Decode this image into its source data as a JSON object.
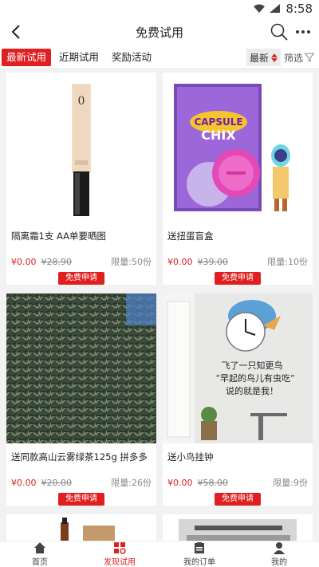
{
  "status": {
    "time": "8:58"
  },
  "header": {
    "title": "免费试用"
  },
  "tabs": [
    {
      "label": "最新试用",
      "active": true
    },
    {
      "label": "近期试用",
      "active": false
    },
    {
      "label": "奖励活动",
      "active": false
    }
  ],
  "sort": {
    "label": "最新"
  },
  "filter": {
    "label": "筛选"
  },
  "products": [
    {
      "name": "隔离霜1支 AA单要晒图",
      "price": "¥0.00",
      "orig": "¥28.90",
      "limit": "限量:50份",
      "button": "免费申请"
    },
    {
      "name": "送扭蛋盲盒",
      "price": "¥0.00",
      "orig": "¥39.00",
      "limit": "限量:10份",
      "button": "免费申请"
    },
    {
      "name": "送同款高山云雾绿茶125g 拼多多",
      "price": "¥0.00",
      "orig": "¥20.00",
      "limit": "限量:26份",
      "button": "免费申请"
    },
    {
      "name": "送小鸟挂钟",
      "price": "¥0.00",
      "orig": "¥58.00",
      "limit": "限量:9份",
      "button": "免费申请"
    }
  ],
  "clock_text": [
    "飞了一只知更鸟",
    "“早起的鸟儿有虫吃”",
    "说的就是我！"
  ],
  "nav": [
    {
      "label": "首页",
      "icon": "home-icon",
      "active": false
    },
    {
      "label": "发现试用",
      "icon": "discover-icon",
      "active": true
    },
    {
      "label": "我的订单",
      "icon": "order-icon",
      "active": false
    },
    {
      "label": "我的",
      "icon": "profile-icon",
      "active": false
    }
  ],
  "colors": {
    "accent": "#e02020"
  }
}
